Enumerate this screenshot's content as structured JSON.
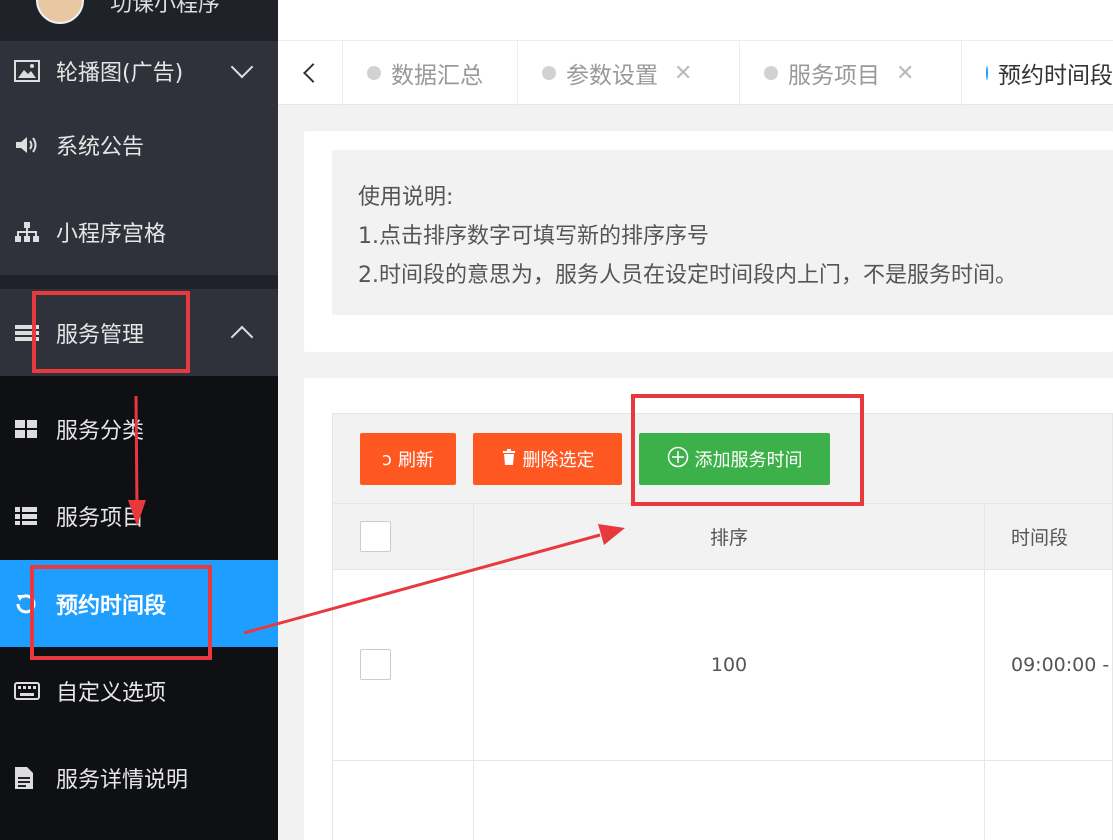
{
  "sidebar": {
    "logo_text": "功课小程序",
    "items": [
      {
        "label": "轮播图(广告)",
        "icon": "image-icon"
      },
      {
        "label": "系统公告",
        "icon": "speaker-icon"
      },
      {
        "label": "小程序宫格",
        "icon": "sitemap-icon"
      },
      {
        "label": "服务管理",
        "icon": "list-icon"
      },
      {
        "label": "服务分类",
        "icon": "grid-icon"
      },
      {
        "label": "服务项目",
        "icon": "list-bullet-icon"
      },
      {
        "label": "预约时间段",
        "icon": "refresh-icon"
      },
      {
        "label": "自定义选项",
        "icon": "keyboard-icon"
      },
      {
        "label": "服务详情说明",
        "icon": "document-icon"
      }
    ]
  },
  "tabs": [
    {
      "label": "数据汇总",
      "closable": false
    },
    {
      "label": "参数设置",
      "closable": true
    },
    {
      "label": "服务项目",
      "closable": true
    },
    {
      "label": "预约时间段",
      "closable": true,
      "active": true
    }
  ],
  "notice": {
    "title": "使用说明:",
    "line1": "1.点击排序数字可填写新的排序序号",
    "line2": "2.时间段的意思为，服务人员在设定时间段内上门，不是服务时间。"
  },
  "toolbar": {
    "refresh_label": "刷新",
    "delete_label": "删除选定",
    "add_label": "添加服务时间"
  },
  "table": {
    "headers": {
      "order": "排序",
      "time": "时间段"
    },
    "rows": [
      {
        "order": "100",
        "time": "09:00:00 -"
      }
    ]
  },
  "colors": {
    "sidebar_bg": "#20222a",
    "active_blue": "#1e9fff",
    "orange_btn": "#ff5722",
    "green_btn": "#3cb149",
    "annotation_red": "#e8393f"
  }
}
